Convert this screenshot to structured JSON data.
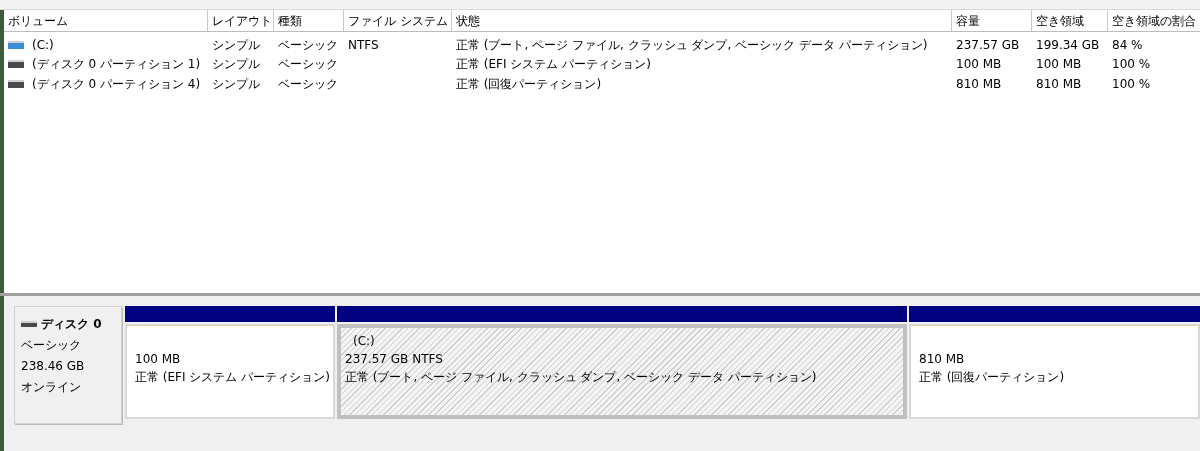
{
  "volume_list": {
    "columns": [
      "ボリューム",
      "レイアウト",
      "種類",
      "ファイル システム",
      "状態",
      "容量",
      "空き領域",
      "空き領域の割合"
    ],
    "rows": [
      {
        "kind": "drive",
        "cells": [
          "(C:)",
          "シンプル",
          "ベーシック",
          "NTFS",
          "正常 (ブート, ページ ファイル, クラッシュ ダンプ, ベーシック データ パーティション)",
          "237.57 GB",
          "199.34 GB",
          "84 %"
        ]
      },
      {
        "kind": "partition",
        "cells": [
          "(ディスク 0 パーティション 1)",
          "シンプル",
          "ベーシック",
          "",
          "正常 (EFI システム パーティション)",
          "100 MB",
          "100 MB",
          "100 %"
        ]
      },
      {
        "kind": "partition",
        "cells": [
          "(ディスク 0 パーティション 4)",
          "シンプル",
          "ベーシック",
          "",
          "正常 (回復パーティション)",
          "810 MB",
          "810 MB",
          "100 %"
        ]
      }
    ]
  },
  "disk_map": {
    "disk": {
      "name": "ディスク 0",
      "type": "ベーシック",
      "size": "238.46 GB",
      "status": "オンライン"
    },
    "partitions": [
      {
        "selected": false,
        "size": "100 MB",
        "status": "正常 (EFI システム パーティション)"
      },
      {
        "selected": true,
        "label": "(C:)",
        "size": "237.57 GB NTFS",
        "status": "正常 (ブート, ページ ファイル, クラッシュ ダンプ, ベーシック データ パーティション)"
      },
      {
        "selected": false,
        "size": "810 MB",
        "status": "正常 (回復パーティション)"
      }
    ]
  }
}
